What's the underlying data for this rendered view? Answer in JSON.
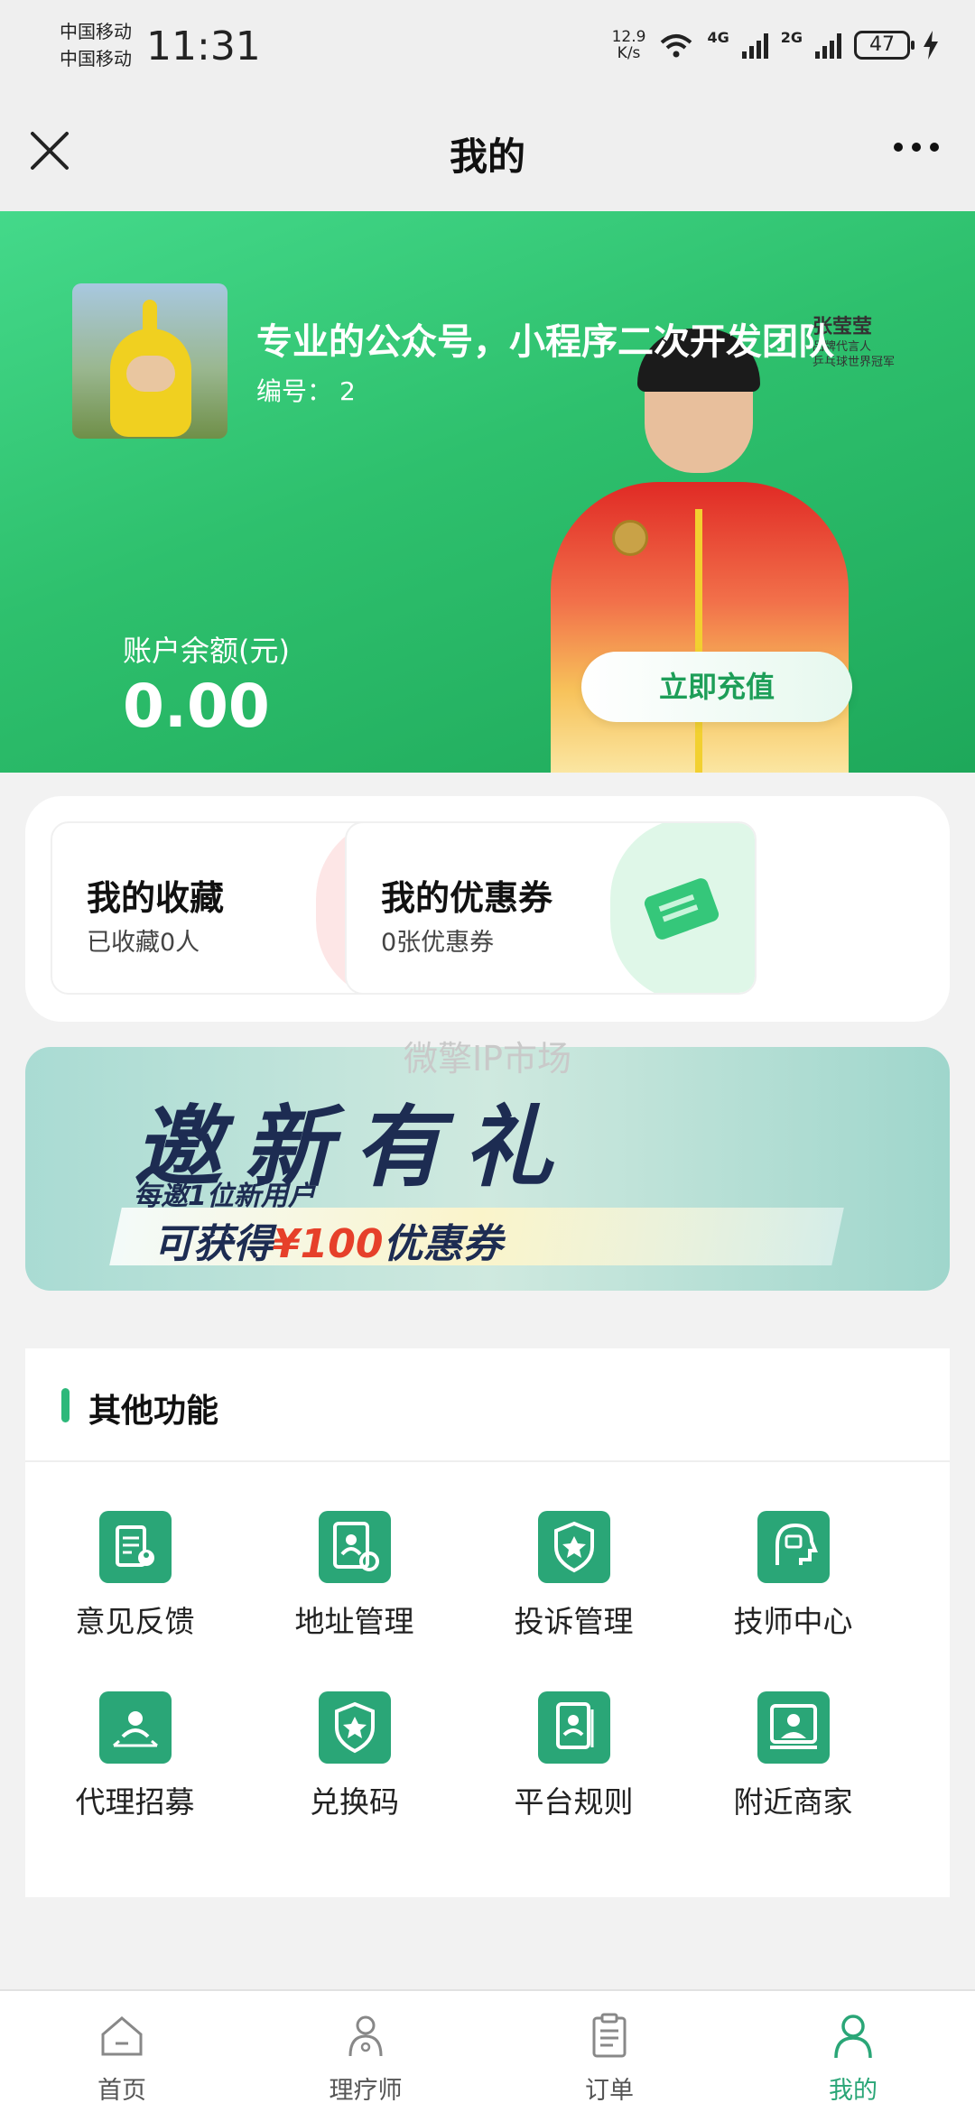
{
  "status_bar": {
    "carrier_1": "中国移动",
    "carrier_2": "中国移动",
    "time": "11:31",
    "net_speed": "12.9",
    "net_speed_unit": "K/s",
    "sim1_type": "4G",
    "sim2_type": "2G",
    "battery": "47"
  },
  "navbar": {
    "title": "我的",
    "close_icon": "close-icon",
    "more_icon": "more-icon"
  },
  "hero": {
    "slogan": "专业的公众号，小程序二次开发团队",
    "user_no_label": "编号：",
    "user_no_value": "2",
    "balance_label": "账户余额(元)",
    "balance_value": "0.00",
    "recharge_button": "立即充值",
    "autograph_name": "张莹莹",
    "autograph_role_1": "品牌代言人",
    "autograph_role_2": "乒乓球世界冠军",
    "colors": {
      "gradient_start": "#44d98a",
      "gradient_end": "#1ea85a"
    }
  },
  "quick_cards": [
    {
      "title": "我的收藏",
      "subtitle": "已收藏0人",
      "icon": "favorites-icon"
    },
    {
      "title": "我的优惠券",
      "subtitle": "0张优惠券",
      "icon": "coupon-icon"
    }
  ],
  "watermark": "微擎IP市场",
  "banner": {
    "title": "邀新有礼",
    "line1": "每邀1位新用户",
    "line2_prefix": "可获得",
    "line2_amount": "¥100",
    "line2_suffix": "优惠券"
  },
  "other_functions": {
    "title": "其他功能",
    "items": [
      {
        "label": "意见反馈",
        "icon": "feedback-icon"
      },
      {
        "label": "地址管理",
        "icon": "address-settings-icon"
      },
      {
        "label": "投诉管理",
        "icon": "complaint-shield-icon"
      },
      {
        "label": "技师中心",
        "icon": "technician-center-icon"
      },
      {
        "label": "代理招募",
        "icon": "agent-recruit-icon"
      },
      {
        "label": "兑换码",
        "icon": "redeem-code-icon"
      },
      {
        "label": "平台规则",
        "icon": "platform-rules-icon"
      },
      {
        "label": "附近商家",
        "icon": "nearby-merchant-icon"
      }
    ],
    "accent_color": "#2aa677"
  },
  "tabbar": {
    "items": [
      {
        "label": "首页",
        "icon": "home-icon",
        "active": false
      },
      {
        "label": "理疗师",
        "icon": "therapist-icon",
        "active": false
      },
      {
        "label": "订单",
        "icon": "orders-icon",
        "active": false
      },
      {
        "label": "我的",
        "icon": "profile-icon",
        "active": true
      }
    ],
    "active_color": "#2aa677"
  }
}
